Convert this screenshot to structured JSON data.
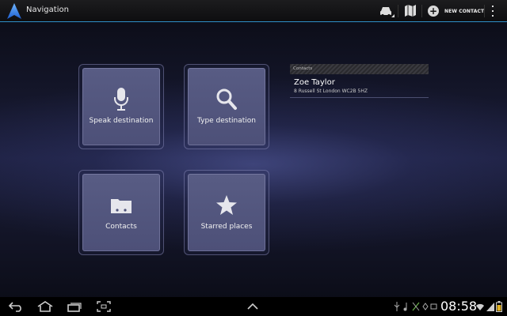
{
  "header": {
    "title": "Navigation",
    "new_contact_label": "NEW CONTACT",
    "accent_color": "#2f8fc9"
  },
  "tiles": [
    {
      "label": "Speak destination",
      "icon": "microphone-icon"
    },
    {
      "label": "Type destination",
      "icon": "magnifier-icon"
    },
    {
      "label": "Contacts",
      "icon": "folder-icon"
    },
    {
      "label": "Starred places",
      "icon": "star-icon"
    }
  ],
  "contacts": {
    "header": "Contacts",
    "items": [
      {
        "name": "Zoe Taylor",
        "address": "8 Russell St London WC2B 5HZ"
      }
    ]
  },
  "system_bar": {
    "time": "08:58",
    "icons": [
      "back-icon",
      "home-icon",
      "recent-apps-icon",
      "screenshot-icon",
      "up-chevron-icon",
      "usb-icon",
      "music-icon",
      "signal-off-icon",
      "wifi-icon",
      "signal-icon",
      "battery-icon"
    ]
  }
}
